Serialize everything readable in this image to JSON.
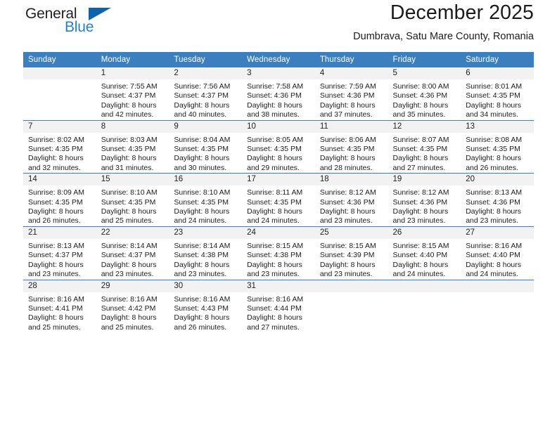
{
  "brand": {
    "name_primary": "General",
    "name_secondary": "Blue",
    "triangle_color": "#0f63ad",
    "secondary_color": "#2a7fc9"
  },
  "header": {
    "title": "December 2025",
    "subtitle": "Dumbrava, Satu Mare County, Romania"
  },
  "theme": {
    "header_row_bg": "#3c7fbe",
    "daynum_band_bg": "#f2f2f2",
    "row_divider": "#3c7fbe"
  },
  "weekday_headers": [
    "Sunday",
    "Monday",
    "Tuesday",
    "Wednesday",
    "Thursday",
    "Friday",
    "Saturday"
  ],
  "weeks": [
    [
      {
        "day": "",
        "sunrise": "",
        "sunset": "",
        "daylight_line1": "",
        "daylight_line2": ""
      },
      {
        "day": "1",
        "sunrise": "Sunrise: 7:55 AM",
        "sunset": "Sunset: 4:37 PM",
        "daylight_line1": "Daylight: 8 hours",
        "daylight_line2": "and 42 minutes."
      },
      {
        "day": "2",
        "sunrise": "Sunrise: 7:56 AM",
        "sunset": "Sunset: 4:37 PM",
        "daylight_line1": "Daylight: 8 hours",
        "daylight_line2": "and 40 minutes."
      },
      {
        "day": "3",
        "sunrise": "Sunrise: 7:58 AM",
        "sunset": "Sunset: 4:36 PM",
        "daylight_line1": "Daylight: 8 hours",
        "daylight_line2": "and 38 minutes."
      },
      {
        "day": "4",
        "sunrise": "Sunrise: 7:59 AM",
        "sunset": "Sunset: 4:36 PM",
        "daylight_line1": "Daylight: 8 hours",
        "daylight_line2": "and 37 minutes."
      },
      {
        "day": "5",
        "sunrise": "Sunrise: 8:00 AM",
        "sunset": "Sunset: 4:36 PM",
        "daylight_line1": "Daylight: 8 hours",
        "daylight_line2": "and 35 minutes."
      },
      {
        "day": "6",
        "sunrise": "Sunrise: 8:01 AM",
        "sunset": "Sunset: 4:35 PM",
        "daylight_line1": "Daylight: 8 hours",
        "daylight_line2": "and 34 minutes."
      }
    ],
    [
      {
        "day": "7",
        "sunrise": "Sunrise: 8:02 AM",
        "sunset": "Sunset: 4:35 PM",
        "daylight_line1": "Daylight: 8 hours",
        "daylight_line2": "and 32 minutes."
      },
      {
        "day": "8",
        "sunrise": "Sunrise: 8:03 AM",
        "sunset": "Sunset: 4:35 PM",
        "daylight_line1": "Daylight: 8 hours",
        "daylight_line2": "and 31 minutes."
      },
      {
        "day": "9",
        "sunrise": "Sunrise: 8:04 AM",
        "sunset": "Sunset: 4:35 PM",
        "daylight_line1": "Daylight: 8 hours",
        "daylight_line2": "and 30 minutes."
      },
      {
        "day": "10",
        "sunrise": "Sunrise: 8:05 AM",
        "sunset": "Sunset: 4:35 PM",
        "daylight_line1": "Daylight: 8 hours",
        "daylight_line2": "and 29 minutes."
      },
      {
        "day": "11",
        "sunrise": "Sunrise: 8:06 AM",
        "sunset": "Sunset: 4:35 PM",
        "daylight_line1": "Daylight: 8 hours",
        "daylight_line2": "and 28 minutes."
      },
      {
        "day": "12",
        "sunrise": "Sunrise: 8:07 AM",
        "sunset": "Sunset: 4:35 PM",
        "daylight_line1": "Daylight: 8 hours",
        "daylight_line2": "and 27 minutes."
      },
      {
        "day": "13",
        "sunrise": "Sunrise: 8:08 AM",
        "sunset": "Sunset: 4:35 PM",
        "daylight_line1": "Daylight: 8 hours",
        "daylight_line2": "and 26 minutes."
      }
    ],
    [
      {
        "day": "14",
        "sunrise": "Sunrise: 8:09 AM",
        "sunset": "Sunset: 4:35 PM",
        "daylight_line1": "Daylight: 8 hours",
        "daylight_line2": "and 26 minutes."
      },
      {
        "day": "15",
        "sunrise": "Sunrise: 8:10 AM",
        "sunset": "Sunset: 4:35 PM",
        "daylight_line1": "Daylight: 8 hours",
        "daylight_line2": "and 25 minutes."
      },
      {
        "day": "16",
        "sunrise": "Sunrise: 8:10 AM",
        "sunset": "Sunset: 4:35 PM",
        "daylight_line1": "Daylight: 8 hours",
        "daylight_line2": "and 24 minutes."
      },
      {
        "day": "17",
        "sunrise": "Sunrise: 8:11 AM",
        "sunset": "Sunset: 4:35 PM",
        "daylight_line1": "Daylight: 8 hours",
        "daylight_line2": "and 24 minutes."
      },
      {
        "day": "18",
        "sunrise": "Sunrise: 8:12 AM",
        "sunset": "Sunset: 4:36 PM",
        "daylight_line1": "Daylight: 8 hours",
        "daylight_line2": "and 23 minutes."
      },
      {
        "day": "19",
        "sunrise": "Sunrise: 8:12 AM",
        "sunset": "Sunset: 4:36 PM",
        "daylight_line1": "Daylight: 8 hours",
        "daylight_line2": "and 23 minutes."
      },
      {
        "day": "20",
        "sunrise": "Sunrise: 8:13 AM",
        "sunset": "Sunset: 4:36 PM",
        "daylight_line1": "Daylight: 8 hours",
        "daylight_line2": "and 23 minutes."
      }
    ],
    [
      {
        "day": "21",
        "sunrise": "Sunrise: 8:13 AM",
        "sunset": "Sunset: 4:37 PM",
        "daylight_line1": "Daylight: 8 hours",
        "daylight_line2": "and 23 minutes."
      },
      {
        "day": "22",
        "sunrise": "Sunrise: 8:14 AM",
        "sunset": "Sunset: 4:37 PM",
        "daylight_line1": "Daylight: 8 hours",
        "daylight_line2": "and 23 minutes."
      },
      {
        "day": "23",
        "sunrise": "Sunrise: 8:14 AM",
        "sunset": "Sunset: 4:38 PM",
        "daylight_line1": "Daylight: 8 hours",
        "daylight_line2": "and 23 minutes."
      },
      {
        "day": "24",
        "sunrise": "Sunrise: 8:15 AM",
        "sunset": "Sunset: 4:38 PM",
        "daylight_line1": "Daylight: 8 hours",
        "daylight_line2": "and 23 minutes."
      },
      {
        "day": "25",
        "sunrise": "Sunrise: 8:15 AM",
        "sunset": "Sunset: 4:39 PM",
        "daylight_line1": "Daylight: 8 hours",
        "daylight_line2": "and 23 minutes."
      },
      {
        "day": "26",
        "sunrise": "Sunrise: 8:15 AM",
        "sunset": "Sunset: 4:40 PM",
        "daylight_line1": "Daylight: 8 hours",
        "daylight_line2": "and 24 minutes."
      },
      {
        "day": "27",
        "sunrise": "Sunrise: 8:16 AM",
        "sunset": "Sunset: 4:40 PM",
        "daylight_line1": "Daylight: 8 hours",
        "daylight_line2": "and 24 minutes."
      }
    ],
    [
      {
        "day": "28",
        "sunrise": "Sunrise: 8:16 AM",
        "sunset": "Sunset: 4:41 PM",
        "daylight_line1": "Daylight: 8 hours",
        "daylight_line2": "and 25 minutes."
      },
      {
        "day": "29",
        "sunrise": "Sunrise: 8:16 AM",
        "sunset": "Sunset: 4:42 PM",
        "daylight_line1": "Daylight: 8 hours",
        "daylight_line2": "and 25 minutes."
      },
      {
        "day": "30",
        "sunrise": "Sunrise: 8:16 AM",
        "sunset": "Sunset: 4:43 PM",
        "daylight_line1": "Daylight: 8 hours",
        "daylight_line2": "and 26 minutes."
      },
      {
        "day": "31",
        "sunrise": "Sunrise: 8:16 AM",
        "sunset": "Sunset: 4:44 PM",
        "daylight_line1": "Daylight: 8 hours",
        "daylight_line2": "and 27 minutes."
      },
      {
        "day": "",
        "sunrise": "",
        "sunset": "",
        "daylight_line1": "",
        "daylight_line2": ""
      },
      {
        "day": "",
        "sunrise": "",
        "sunset": "",
        "daylight_line1": "",
        "daylight_line2": ""
      },
      {
        "day": "",
        "sunrise": "",
        "sunset": "",
        "daylight_line1": "",
        "daylight_line2": ""
      }
    ]
  ]
}
